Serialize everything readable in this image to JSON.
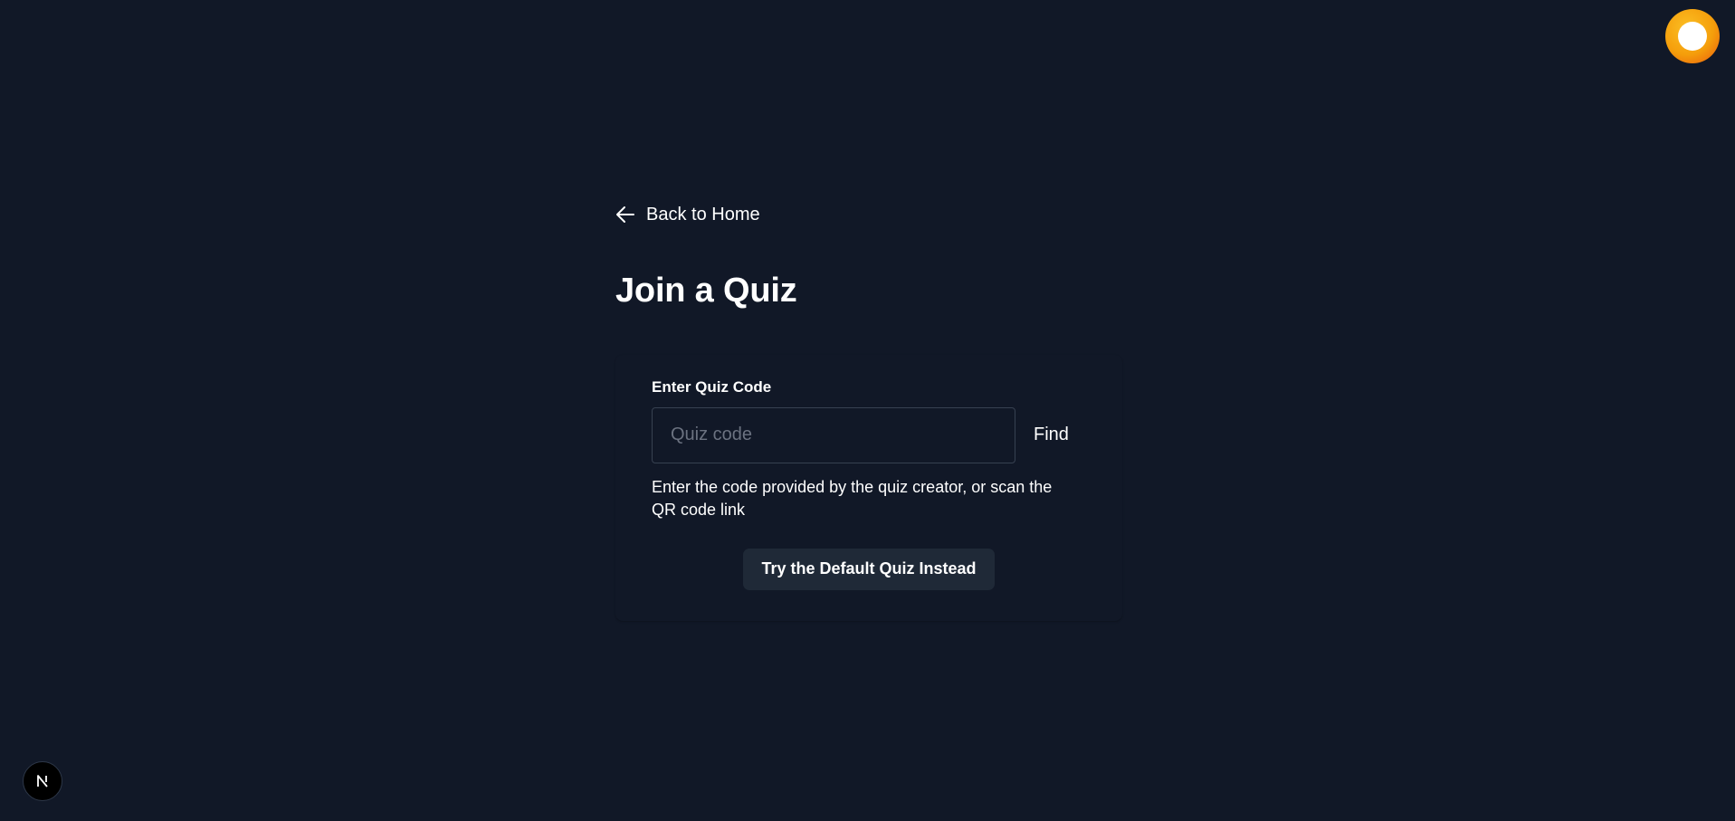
{
  "nav": {
    "back_label": "Back to Home",
    "back_icon": "arrow-left-icon"
  },
  "page": {
    "title": "Join a Quiz"
  },
  "form": {
    "label": "Enter Quiz Code",
    "input_placeholder": "Quiz code",
    "input_value": "",
    "find_label": "Find",
    "helper_text": "Enter the code provided by the quiz creator, or scan the QR code link",
    "default_button_label": "Try the Default Quiz Instead"
  },
  "corner": {
    "avatar_icon": "user-avatar-icon",
    "dev_badge_letter": "N"
  },
  "colors": {
    "background": "#111827",
    "input_border": "#374151",
    "secondary_button_bg": "#1f2937",
    "avatar_orange": "#f59e0b",
    "text": "#ffffff"
  }
}
